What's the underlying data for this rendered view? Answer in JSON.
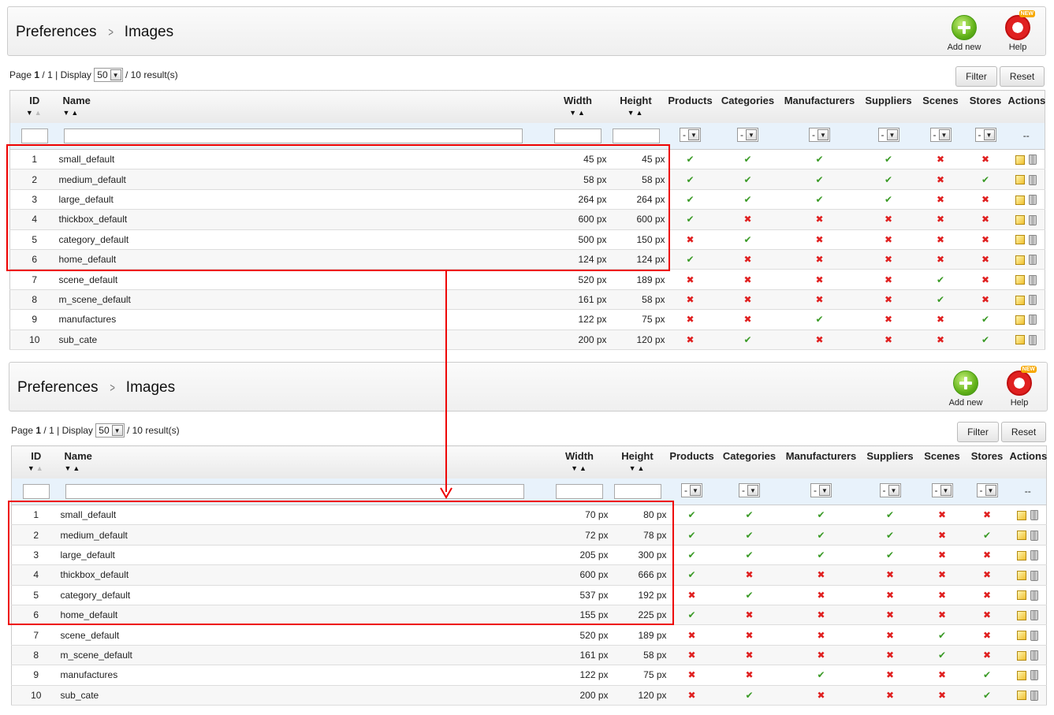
{
  "breadcrumb": {
    "parent": "Preferences",
    "current": "Images"
  },
  "toolbar": {
    "add_label": "Add new",
    "help_label": "Help",
    "help_badge": "NEW"
  },
  "pager": {
    "page_label": "Page",
    "page": "1",
    "pages": "1",
    "display_label": "Display",
    "per_page": "50",
    "results": "/ 10 result(s)"
  },
  "buttons": {
    "filter": "Filter",
    "reset": "Reset"
  },
  "columns": {
    "id": "ID",
    "name": "Name",
    "width": "Width",
    "height": "Height",
    "products": "Products",
    "categories": "Categories",
    "manufacturers": "Manufacturers",
    "suppliers": "Suppliers",
    "scenes": "Scenes",
    "stores": "Stores",
    "actions": "Actions"
  },
  "filter": {
    "select_value": "-",
    "actions_placeholder": "--"
  },
  "icons": {
    "sort_desc": "sort-desc-icon",
    "sort_asc": "sort-asc-icon",
    "yes": "check-icon",
    "no": "cross-icon",
    "edit": "edit-icon",
    "delete": "trash-icon"
  },
  "highlight_color": "#e00000",
  "tables": [
    {
      "rows": [
        {
          "id": "1",
          "name": "small_default",
          "width": "45 px",
          "height": "45 px",
          "flags": [
            1,
            1,
            1,
            1,
            0,
            0
          ]
        },
        {
          "id": "2",
          "name": "medium_default",
          "width": "58 px",
          "height": "58 px",
          "flags": [
            1,
            1,
            1,
            1,
            0,
            1
          ]
        },
        {
          "id": "3",
          "name": "large_default",
          "width": "264 px",
          "height": "264 px",
          "flags": [
            1,
            1,
            1,
            1,
            0,
            0
          ]
        },
        {
          "id": "4",
          "name": "thickbox_default",
          "width": "600 px",
          "height": "600 px",
          "flags": [
            1,
            0,
            0,
            0,
            0,
            0
          ]
        },
        {
          "id": "5",
          "name": "category_default",
          "width": "500 px",
          "height": "150 px",
          "flags": [
            0,
            1,
            0,
            0,
            0,
            0
          ]
        },
        {
          "id": "6",
          "name": "home_default",
          "width": "124 px",
          "height": "124 px",
          "flags": [
            1,
            0,
            0,
            0,
            0,
            0
          ]
        },
        {
          "id": "7",
          "name": "scene_default",
          "width": "520 px",
          "height": "189 px",
          "flags": [
            0,
            0,
            0,
            0,
            1,
            0
          ]
        },
        {
          "id": "8",
          "name": "m_scene_default",
          "width": "161 px",
          "height": "58 px",
          "flags": [
            0,
            0,
            0,
            0,
            1,
            0
          ]
        },
        {
          "id": "9",
          "name": "manufactures",
          "width": "122 px",
          "height": "75 px",
          "flags": [
            0,
            0,
            1,
            0,
            0,
            1
          ]
        },
        {
          "id": "10",
          "name": "sub_cate",
          "width": "200 px",
          "height": "120 px",
          "flags": [
            0,
            1,
            0,
            0,
            0,
            1
          ]
        }
      ]
    },
    {
      "rows": [
        {
          "id": "1",
          "name": "small_default",
          "width": "70 px",
          "height": "80 px",
          "flags": [
            1,
            1,
            1,
            1,
            0,
            0
          ]
        },
        {
          "id": "2",
          "name": "medium_default",
          "width": "72 px",
          "height": "78 px",
          "flags": [
            1,
            1,
            1,
            1,
            0,
            1
          ]
        },
        {
          "id": "3",
          "name": "large_default",
          "width": "205 px",
          "height": "300 px",
          "flags": [
            1,
            1,
            1,
            1,
            0,
            0
          ]
        },
        {
          "id": "4",
          "name": "thickbox_default",
          "width": "600 px",
          "height": "666 px",
          "flags": [
            1,
            0,
            0,
            0,
            0,
            0
          ]
        },
        {
          "id": "5",
          "name": "category_default",
          "width": "537 px",
          "height": "192 px",
          "flags": [
            0,
            1,
            0,
            0,
            0,
            0
          ]
        },
        {
          "id": "6",
          "name": "home_default",
          "width": "155 px",
          "height": "225 px",
          "flags": [
            1,
            0,
            0,
            0,
            0,
            0
          ]
        },
        {
          "id": "7",
          "name": "scene_default",
          "width": "520 px",
          "height": "189 px",
          "flags": [
            0,
            0,
            0,
            0,
            1,
            0
          ]
        },
        {
          "id": "8",
          "name": "m_scene_default",
          "width": "161 px",
          "height": "58 px",
          "flags": [
            0,
            0,
            0,
            0,
            1,
            0
          ]
        },
        {
          "id": "9",
          "name": "manufactures",
          "width": "122 px",
          "height": "75 px",
          "flags": [
            0,
            0,
            1,
            0,
            0,
            1
          ]
        },
        {
          "id": "10",
          "name": "sub_cate",
          "width": "200 px",
          "height": "120 px",
          "flags": [
            0,
            1,
            0,
            0,
            0,
            1
          ]
        }
      ]
    }
  ]
}
